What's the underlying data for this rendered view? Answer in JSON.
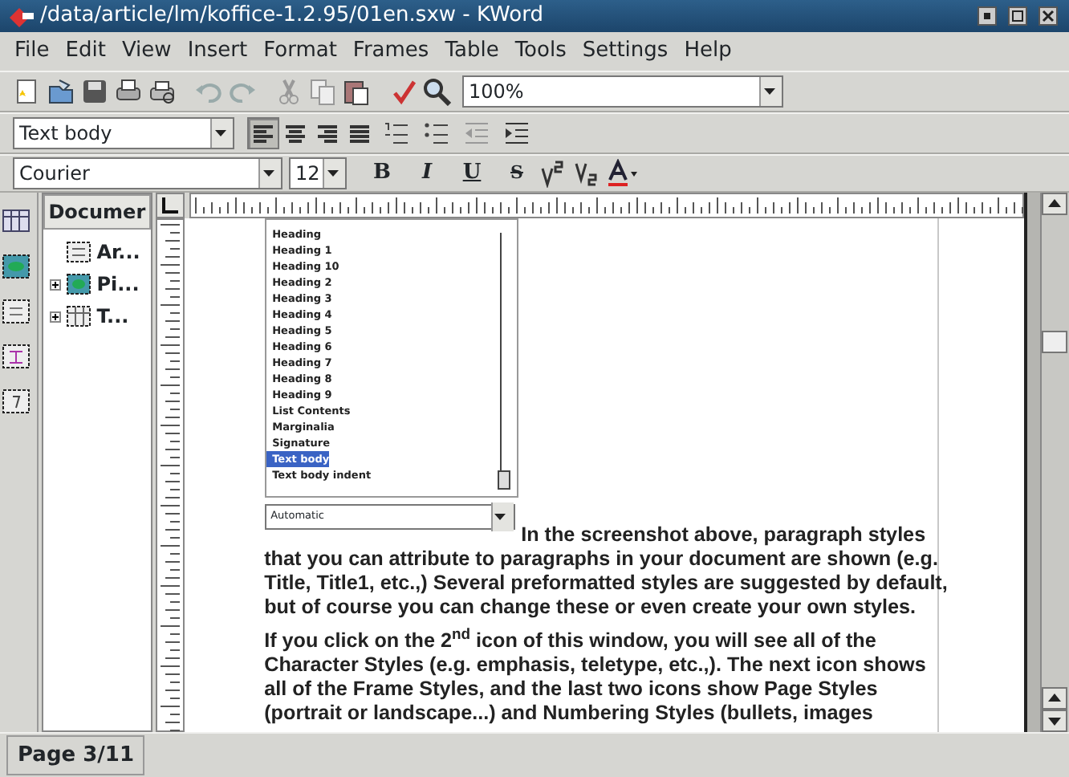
{
  "window": {
    "title": "/data/article/lm/koffice-1.2.95/01en.sxw - KWord"
  },
  "menu": [
    "File",
    "Edit",
    "View",
    "Insert",
    "Format",
    "Frames",
    "Table",
    "Tools",
    "Settings",
    "Help"
  ],
  "toolbar": {
    "zoom": "100%"
  },
  "format_bar": {
    "style": "Text body",
    "alignments": [
      {
        "kind": "left",
        "selected": true
      },
      {
        "kind": "center",
        "selected": false
      },
      {
        "kind": "right",
        "selected": false
      },
      {
        "kind": "justify",
        "selected": false
      }
    ]
  },
  "font_bar": {
    "font": "Courier",
    "size": "12",
    "styles": [
      {
        "kind": "bold",
        "label": "B"
      },
      {
        "kind": "italic",
        "label": "I"
      },
      {
        "kind": "underline",
        "label": "U"
      },
      {
        "kind": "strike",
        "label": "S"
      }
    ]
  },
  "doc_structure": {
    "title": "Documer",
    "items": [
      {
        "kind": "text",
        "label": "Ar..."
      },
      {
        "kind": "picture",
        "label": "Pi...",
        "expanded": false
      },
      {
        "kind": "table",
        "label": "T...",
        "expanded": false
      }
    ]
  },
  "document": {
    "style_list": {
      "items": [
        {
          "label": "Heading",
          "selected": false
        },
        {
          "label": "Heading 1",
          "selected": false
        },
        {
          "label": "Heading 10",
          "selected": false
        },
        {
          "label": "Heading 2",
          "selected": false
        },
        {
          "label": "Heading 3",
          "selected": false
        },
        {
          "label": "Heading 4",
          "selected": false
        },
        {
          "label": "Heading 5",
          "selected": false
        },
        {
          "label": "Heading 6",
          "selected": false
        },
        {
          "label": "Heading 7",
          "selected": false
        },
        {
          "label": "Heading 8",
          "selected": false
        },
        {
          "label": "Heading 9",
          "selected": false
        },
        {
          "label": "List Contents",
          "selected": false
        },
        {
          "label": "Marginalia",
          "selected": false
        },
        {
          "label": "Signature",
          "selected": false
        },
        {
          "label": "Text body",
          "selected": true
        },
        {
          "label": "Text body indent",
          "selected": false
        }
      ],
      "combo": "Automatic"
    },
    "paragraphs": [
      {
        "lines": [
          "In the screenshot above, paragraph styles",
          "that you can attribute to paragraphs in your document are shown (e.g.",
          "Title, Title1, etc.,) Several preformatted styles are suggested by default,",
          "but of course you can change these or even create your own styles."
        ]
      },
      {
        "lines": [
          "If you click on the 2$^{nd}$ icon of this window, you will see all of the",
          "Character Styles (e.g. emphasis, teletype, etc.,). The next icon shows",
          "all of the Frame Styles, and the last two icons show Page Styles",
          "(portrait or landscape...) and Numbering Styles (bullets, images"
        ]
      }
    ]
  },
  "status_bar": {
    "page": "Page 3/11"
  }
}
